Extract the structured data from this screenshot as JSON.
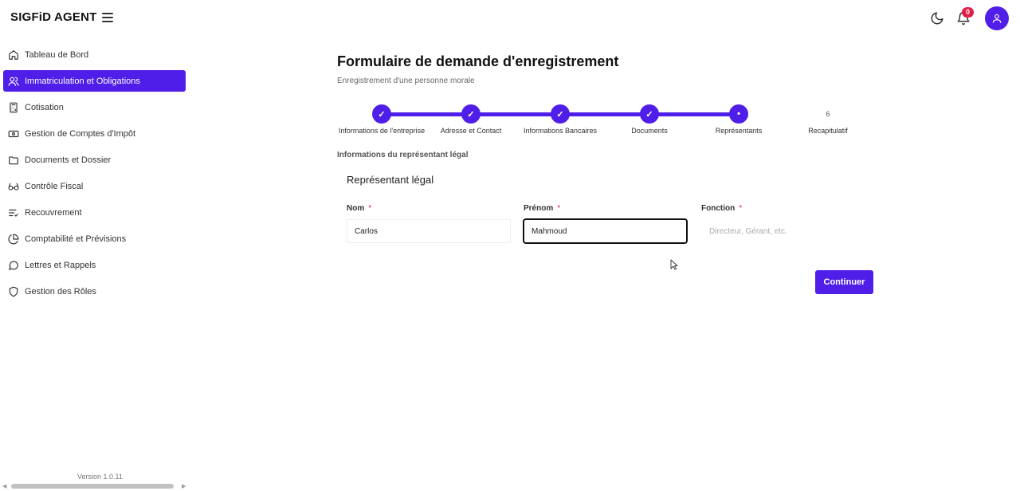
{
  "app": {
    "brand": "SIGFiD AGENT"
  },
  "header": {
    "notification_count": "0"
  },
  "sidebar": {
    "items": [
      {
        "label": "Tableau de Bord",
        "icon": "home-icon"
      },
      {
        "label": "Immatriculation et Obligations",
        "icon": "users-icon",
        "active": true
      },
      {
        "label": "Cotisation",
        "icon": "calculator-icon"
      },
      {
        "label": "Gestion de Comptes d'Impôt",
        "icon": "banknote-icon"
      },
      {
        "label": "Documents et Dossier",
        "icon": "folder-icon"
      },
      {
        "label": "Contrôle Fiscal",
        "icon": "glasses-icon"
      },
      {
        "label": "Recouvrement",
        "icon": "list-check-icon"
      },
      {
        "label": "Comptabilité et Prévisions",
        "icon": "pie-chart-icon"
      },
      {
        "label": "Lettres et Rappels",
        "icon": "message-circle-icon"
      },
      {
        "label": "Gestion des Rôles",
        "icon": "shield-icon"
      }
    ],
    "version": "Version 1.0.11"
  },
  "main": {
    "title": "Formulaire de demande d'enregistrement",
    "subtitle": "Enregistrement d'une personne morale",
    "steps": [
      {
        "label": "Informations de l'entreprise",
        "marker": "✓",
        "state": "done"
      },
      {
        "label": "Adresse et Contact",
        "marker": "✓",
        "state": "done"
      },
      {
        "label": "Informations Bancaires",
        "marker": "✓",
        "state": "done"
      },
      {
        "label": "Documents",
        "marker": "✓",
        "state": "done"
      },
      {
        "label": "Représentants",
        "marker": "•",
        "state": "current"
      },
      {
        "label": "Recapitulatif",
        "marker": "6",
        "state": "pending"
      }
    ],
    "section_label": "Informations du représentant légal",
    "card_title": "Représentant légal",
    "fields": {
      "nom": {
        "label": "Nom",
        "required": "*",
        "value": "Carlos"
      },
      "prenom": {
        "label": "Prénom",
        "required": "*",
        "value": "Mahmoud"
      },
      "fonction": {
        "label": "Fonction",
        "required": "*",
        "value": "",
        "placeholder": "Directeur, Gérant, etc."
      }
    },
    "continue_label": "Continuer"
  },
  "colors": {
    "accent": "#4f1ee8",
    "badge": "#e11d48"
  }
}
